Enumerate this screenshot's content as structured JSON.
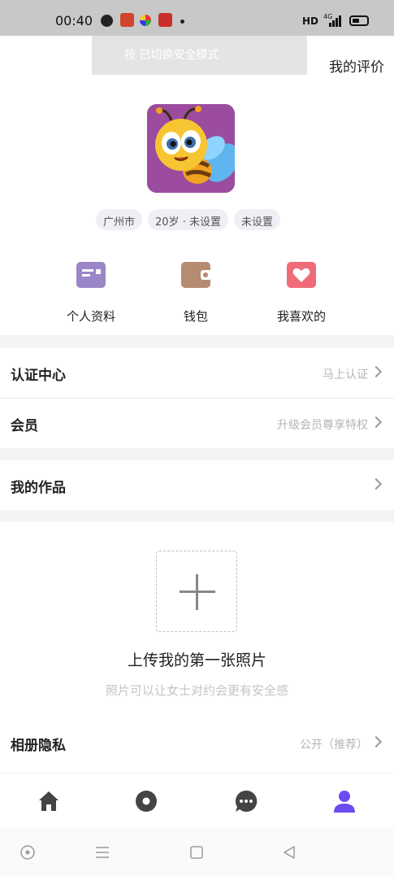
{
  "status_bar": {
    "time": "00:40",
    "network": "HD",
    "signal_type": "4G"
  },
  "toast": {
    "text": "按  已切换安全模式"
  },
  "header": {
    "my_reviews": "我的评价"
  },
  "profile": {
    "avatar": "bee-avatar",
    "tags": [
      "广州市",
      "20岁 · 未设置",
      "未设置"
    ]
  },
  "quick_actions": [
    {
      "label": "个人资料",
      "icon": "profile-card-icon",
      "color": "#9b86c8"
    },
    {
      "label": "钱包",
      "icon": "wallet-icon",
      "color": "#b78a72"
    },
    {
      "label": "我喜欢的",
      "icon": "heart-icon",
      "color": "#f06b7a"
    }
  ],
  "menu": {
    "verification": {
      "title": "认证中心",
      "value": "马上认证"
    },
    "membership": {
      "title": "会员",
      "value": "升级会员尊享特权"
    },
    "works": {
      "title": "我的作品",
      "value": ""
    },
    "album_privacy": {
      "title": "相册隐私",
      "value": "公开（推荐）"
    }
  },
  "upload": {
    "title": "上传我的第一张照片",
    "subtitle": "照片可以让女士对约会更有安全感"
  },
  "tabs": [
    {
      "name": "home",
      "icon": "home-icon",
      "active": false
    },
    {
      "name": "discover",
      "icon": "circle-dot-icon",
      "active": false
    },
    {
      "name": "messages",
      "icon": "chat-icon",
      "active": false
    },
    {
      "name": "me",
      "icon": "person-icon",
      "active": true
    }
  ],
  "colors": {
    "accent": "#6a4cf0",
    "tab_inactive": "#444444",
    "page_gap": "#f4f4f6"
  }
}
